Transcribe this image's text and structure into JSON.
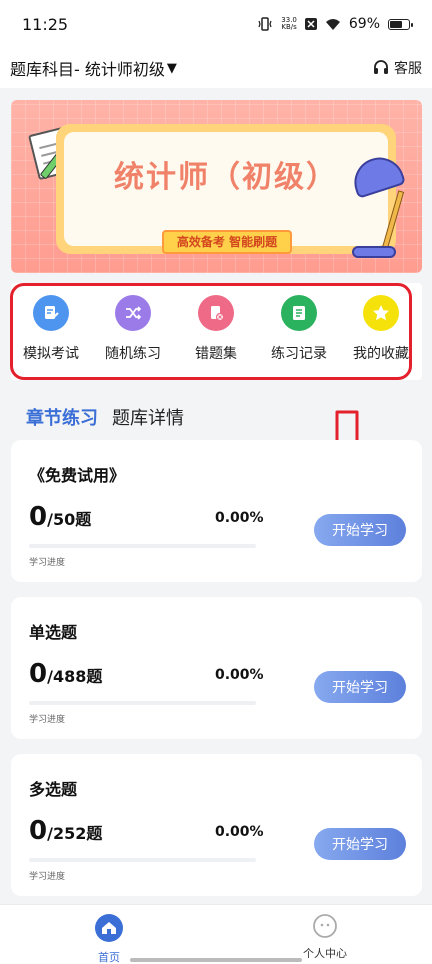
{
  "status_bar": {
    "time": "11:25",
    "net_speed_value": "33.0",
    "net_speed_unit": "KB/s",
    "battery": "69%"
  },
  "header": {
    "subject": "题库科目- 统计师初级",
    "service_label": "客服"
  },
  "banner": {
    "title": "统计师（初级）",
    "tag": "高效备考 智能刷题"
  },
  "quick_actions": [
    {
      "label": "模拟考试",
      "icon": "exam-icon",
      "color": "#4e95f0"
    },
    {
      "label": "随机练习",
      "icon": "shuffle-icon",
      "color": "#9b7be8"
    },
    {
      "label": "错题集",
      "icon": "wrong-questions-icon",
      "color": "#ee6a86"
    },
    {
      "label": "练习记录",
      "icon": "record-icon",
      "color": "#2ab25e"
    },
    {
      "label": "我的收藏",
      "icon": "star-icon",
      "color": "#f5e20a"
    }
  ],
  "tabs": [
    {
      "label": "章节练习",
      "active": true
    },
    {
      "label": "题库详情",
      "active": false
    }
  ],
  "cards": [
    {
      "title": "《免费试用》",
      "done": "0",
      "total": "/50题",
      "percent": "0.00%",
      "progress": 0,
      "progress_label": "学习进度",
      "button": "开始学习"
    },
    {
      "title": "单选题",
      "done": "0",
      "total": "/488题",
      "percent": "0.00%",
      "progress": 0,
      "progress_label": "学习进度",
      "button": "开始学习"
    },
    {
      "title": "多选题",
      "done": "0",
      "total": "/252题",
      "percent": "0.00%",
      "progress": 0,
      "progress_label": "学习进度",
      "button": "开始学习"
    }
  ],
  "bottom_nav": [
    {
      "label": "首页",
      "icon": "home-icon",
      "active": true
    },
    {
      "label": "个人中心",
      "icon": "profile-icon",
      "active": false
    }
  ],
  "colors": {
    "accent": "#3b6fd6",
    "annotation_red": "#e3202c"
  }
}
